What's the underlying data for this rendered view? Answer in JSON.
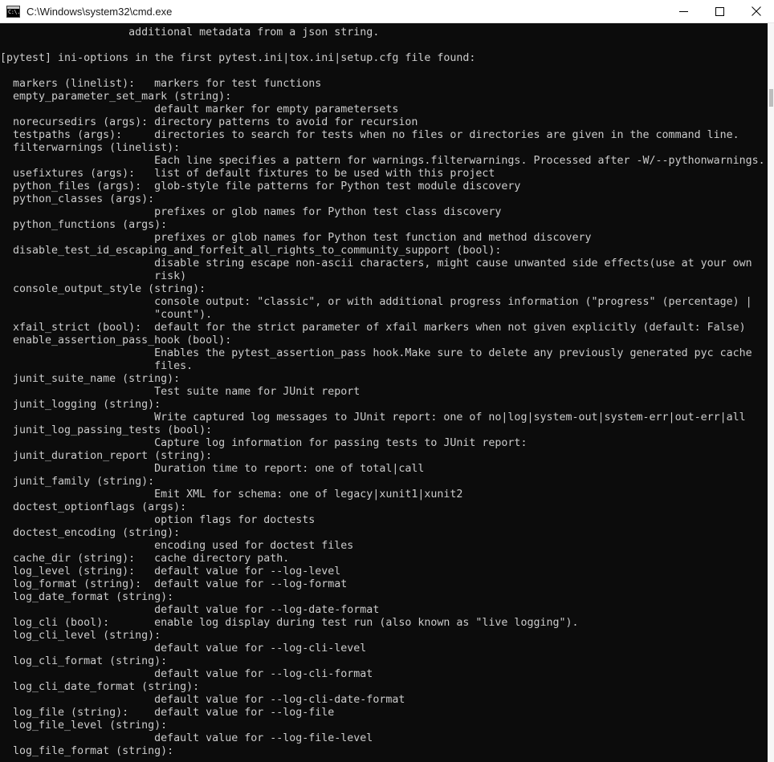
{
  "window": {
    "title": "C:\\Windows\\system32\\cmd.exe",
    "icon": "console-icon",
    "icon_glyph": "C:\\.",
    "background_color": "#0c0c0c",
    "text_color": "#cccccc",
    "titlebar_color": "#ffffff"
  },
  "titlebar": {
    "minimize_label": "Minimize",
    "maximize_label": "Maximize",
    "close_label": "Close"
  },
  "scrollbar": {
    "orientation": "vertical",
    "thumb_visible": true
  },
  "console": {
    "content": "                    additional metadata from a json string.\n\n[pytest] ini-options in the first pytest.ini|tox.ini|setup.cfg file found:\n\n  markers (linelist):   markers for test functions\n  empty_parameter_set_mark (string):\n                        default marker for empty parametersets\n  norecursedirs (args): directory patterns to avoid for recursion\n  testpaths (args):     directories to search for tests when no files or directories are given in the command line.\n  filterwarnings (linelist):\n                        Each line specifies a pattern for warnings.filterwarnings. Processed after -W/--pythonwarnings.\n  usefixtures (args):   list of default fixtures to be used with this project\n  python_files (args):  glob-style file patterns for Python test module discovery\n  python_classes (args):\n                        prefixes or glob names for Python test class discovery\n  python_functions (args):\n                        prefixes or glob names for Python test function and method discovery\n  disable_test_id_escaping_and_forfeit_all_rights_to_community_support (bool):\n                        disable string escape non-ascii characters, might cause unwanted side effects(use at your own\n                        risk)\n  console_output_style (string):\n                        console output: \"classic\", or with additional progress information (\"progress\" (percentage) |\n                        \"count\").\n  xfail_strict (bool):  default for the strict parameter of xfail markers when not given explicitly (default: False)\n  enable_assertion_pass_hook (bool):\n                        Enables the pytest_assertion_pass hook.Make sure to delete any previously generated pyc cache\n                        files.\n  junit_suite_name (string):\n                        Test suite name for JUnit report\n  junit_logging (string):\n                        Write captured log messages to JUnit report: one of no|log|system-out|system-err|out-err|all\n  junit_log_passing_tests (bool):\n                        Capture log information for passing tests to JUnit report:\n  junit_duration_report (string):\n                        Duration time to report: one of total|call\n  junit_family (string):\n                        Emit XML for schema: one of legacy|xunit1|xunit2\n  doctest_optionflags (args):\n                        option flags for doctests\n  doctest_encoding (string):\n                        encoding used for doctest files\n  cache_dir (string):   cache directory path.\n  log_level (string):   default value for --log-level\n  log_format (string):  default value for --log-format\n  log_date_format (string):\n                        default value for --log-date-format\n  log_cli (bool):       enable log display during test run (also known as \"live logging\").\n  log_cli_level (string):\n                        default value for --log-cli-level\n  log_cli_format (string):\n                        default value for --log-cli-format\n  log_cli_date_format (string):\n                        default value for --log-cli-date-format\n  log_file (string):    default value for --log-file\n  log_file_level (string):\n                        default value for --log-file-level\n  log_file_format (string):"
  }
}
